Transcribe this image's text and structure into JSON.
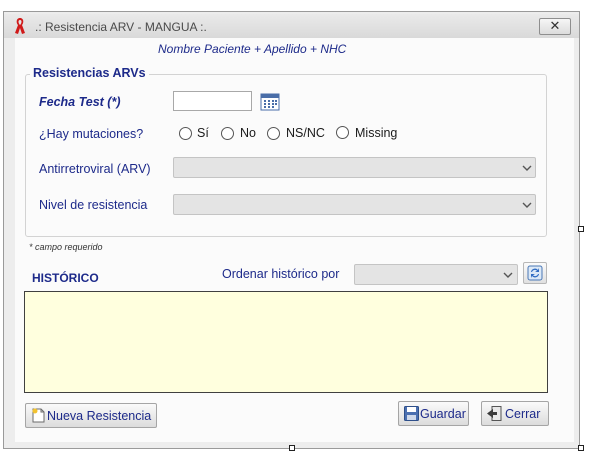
{
  "window": {
    "title": ".: Resistencia ARV - MANGUA :.",
    "close_label": "✕"
  },
  "patient_line": "Nombre Paciente + Apellido + NHC",
  "section": {
    "legend": "Resistencias ARVs",
    "fecha_label": "Fecha Test (*)",
    "fecha_value": "",
    "mutaciones_label": "¿Hay mutaciones?",
    "options": [
      "Sí",
      "No",
      "NS/NC",
      "Missing"
    ],
    "arv_label": "Antirretroviral (ARV)",
    "arv_value": "",
    "nivel_label": "Nivel de resistencia",
    "nivel_value": ""
  },
  "required_note": "* campo requerido",
  "historico": {
    "title": "HISTÓRICO",
    "order_label": "Ordenar histórico por",
    "order_value": ""
  },
  "buttons": {
    "nueva": "Nueva Resistencia",
    "guardar": "Guardar",
    "cerrar": "Cerrar"
  },
  "colors": {
    "accent": "#1d2a8a",
    "history_bg": "#ffffde",
    "ribbon": "#d01a1a"
  },
  "icons": [
    "ribbon-icon",
    "calendar-icon",
    "chevron-down-icon",
    "refresh-icon",
    "new-document-icon",
    "save-icon",
    "exit-icon"
  ]
}
